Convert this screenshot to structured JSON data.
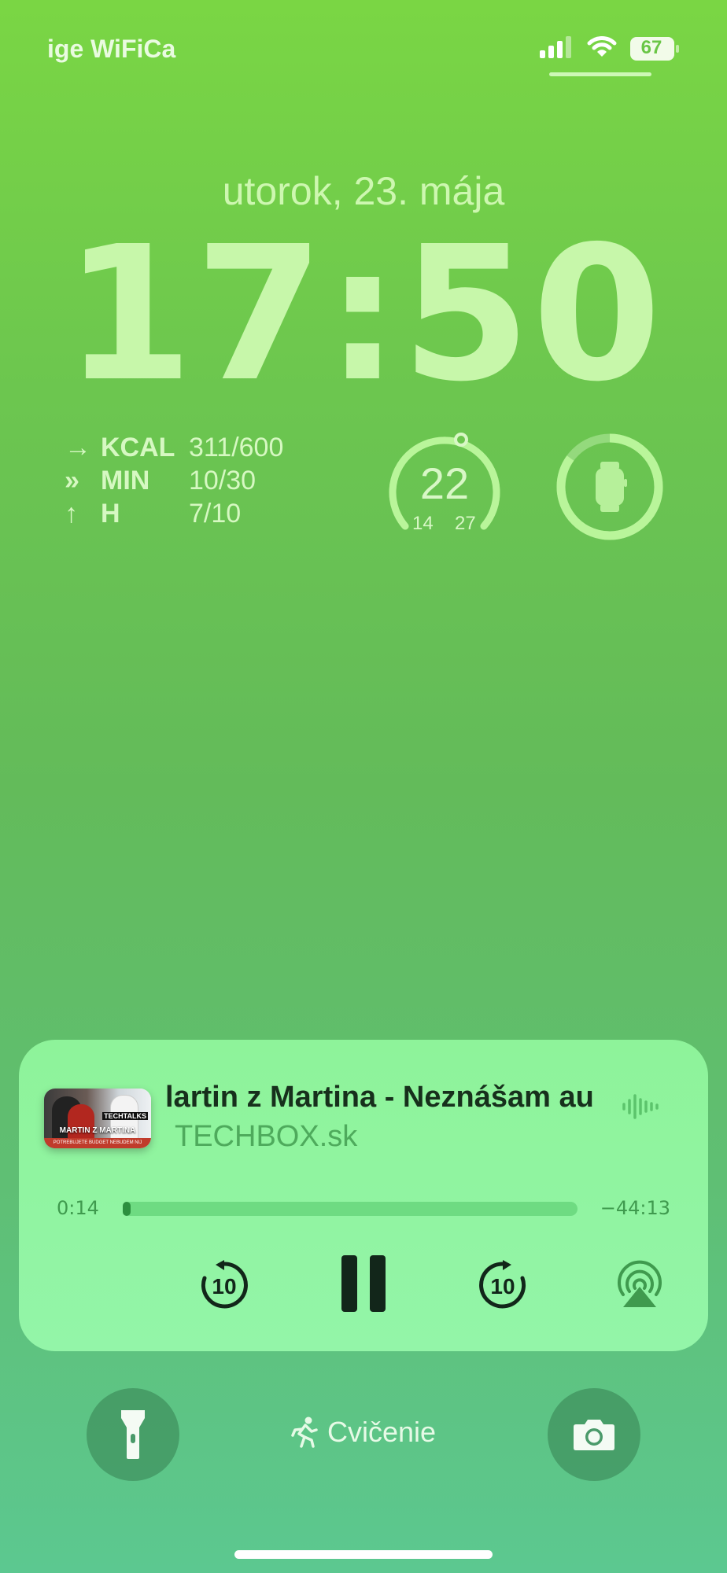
{
  "status_bar": {
    "carrier": "ige WiFiCa",
    "battery": "67"
  },
  "lock": {
    "date": "utorok, 23. mája",
    "time": "17:50"
  },
  "activity": {
    "rows": [
      {
        "label": "KCAL",
        "value": "311/600"
      },
      {
        "label": "MIN",
        "value": "10/30"
      },
      {
        "label": "H",
        "value": "7/10"
      }
    ]
  },
  "weather_widget": {
    "current": "22",
    "low": "14",
    "high": "27"
  },
  "watch_widget": {
    "battery_fraction": 0.85
  },
  "now_playing": {
    "title": "lartin z Martina - Neznášam au",
    "source": "TECHBOX.sk",
    "elapsed": "0:14",
    "remaining": "−44:13",
    "progress_fraction": 0.005,
    "skip_back_label": "10",
    "skip_forward_label": "10",
    "artwork": {
      "badge": "TECHTALKS",
      "caption": "MARTIN Z MARTINA",
      "footer": "POTREBUJETE BUDGET NEBUDEM NIJ"
    }
  },
  "bottom": {
    "focus_label": "Cvičenie"
  },
  "icons": {
    "signal": "signal-icon",
    "wifi": "wifi-icon",
    "battery": "battery-icon",
    "flashlight": "flashlight-icon",
    "camera": "camera-icon",
    "airplay": "airplay-icon",
    "waveform": "waveform-icon",
    "runner": "runner-icon",
    "watch": "watch-icon"
  },
  "colors": {
    "player_bg": "#93f5a8",
    "player_text": "#17301c",
    "accent": "#2c8f3f"
  }
}
